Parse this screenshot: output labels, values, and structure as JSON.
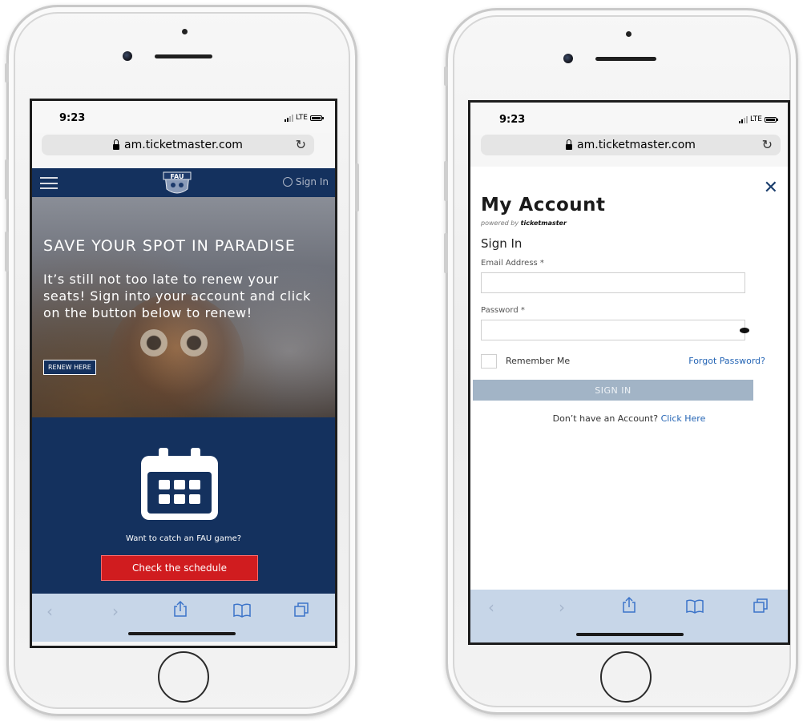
{
  "left_phone": {
    "status": {
      "time": "9:23",
      "network": "LTE"
    },
    "url": "am.ticketmaster.com",
    "nav": {
      "sign_in": "Sign In"
    },
    "hero": {
      "title": "SAVE YOUR SPOT IN PARADISE",
      "body": "It’s still not too late to renew your seats! Sign into your account and click on the button below to renew!",
      "button": "RENEW HERE"
    },
    "promo": {
      "text": "Want to catch an FAU game?",
      "button": "Check the schedule"
    },
    "toolbar": [
      "back-icon",
      "forward-icon",
      "share-icon",
      "bookmarks-icon",
      "tabs-icon"
    ]
  },
  "right_phone": {
    "status": {
      "time": "9:23",
      "network": "LTE"
    },
    "url": "am.ticketmaster.com",
    "account": {
      "title": "My Account",
      "powered_prefix": "powered by",
      "powered_brand": "ticketmaster",
      "heading": "Sign In",
      "email_label": "Email Address *",
      "email_value": "",
      "password_label": "Password *",
      "password_value": "",
      "remember": "Remember Me",
      "forgot": "Forgot Password?",
      "submit": "SIGN IN",
      "no_account": "Don’t have an Account?",
      "click_here": "Click Here"
    },
    "toolbar": [
      "back-icon",
      "forward-icon",
      "share-icon",
      "bookmarks-icon",
      "tabs-icon"
    ]
  },
  "colors": {
    "navy": "#14315e",
    "red": "#d01c1f",
    "toolbar": "#c7d6e8",
    "link": "#2565b5",
    "disabled_button": "#a2b4c6"
  }
}
